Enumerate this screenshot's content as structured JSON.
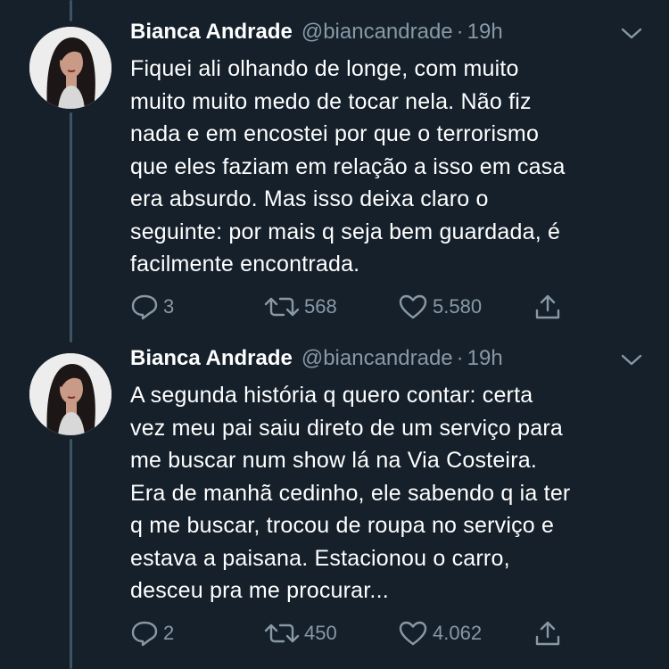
{
  "tweets": [
    {
      "author": {
        "name": "Bianca Andrade",
        "handle": "@biancandrade",
        "separator": "·",
        "time": "19h"
      },
      "lines": [
        "Fiquei ali olhando de longe, com muito",
        "muito muito medo de tocar nela. Não fiz",
        "nada e em encostei por que o terrorismo",
        "que eles faziam em relação a isso em casa",
        "era absurdo. Mas isso deixa claro o",
        "seguinte: por mais q seja bem guardada, é",
        "facilmente encontrada."
      ],
      "stats": {
        "replies": "3",
        "retweets": "568",
        "likes": "5.580"
      }
    },
    {
      "author": {
        "name": "Bianca Andrade",
        "handle": "@biancandrade",
        "separator": "·",
        "time": "19h"
      },
      "lines": [
        "A segunda história q quero contar: certa",
        "vez meu pai saiu direto de um serviço para",
        "me buscar num show lá na Via Costeira.",
        "Era de manhã cedinho, ele sabendo q ia ter",
        "q me buscar, trocou de roupa no serviço e",
        "estava a paisana. Estacionou o carro,",
        "desceu pra me procurar..."
      ],
      "stats": {
        "replies": "2",
        "retweets": "450",
        "likes": "4.062"
      }
    }
  ],
  "icons": {
    "reply": "reply-icon",
    "retweet": "retweet-icon",
    "like": "heart-icon",
    "share": "share-icon",
    "menu": "chevron-down-icon"
  },
  "colors": {
    "background": "#15202b",
    "secondary_text": "#8899a6",
    "thread_line": "#3d5466"
  }
}
